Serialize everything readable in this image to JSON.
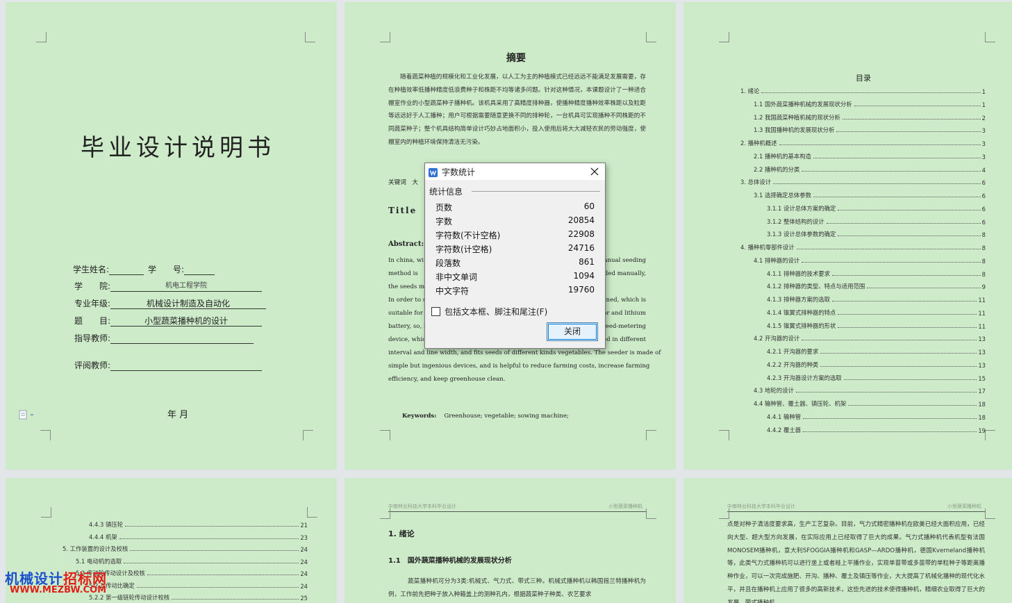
{
  "cover": {
    "title": "毕业设计说明书",
    "fields": [
      {
        "label": "学生姓名:",
        "value": ""
      },
      {
        "label": "学　　号:",
        "value": ""
      },
      {
        "label": "学　　院:",
        "value": "机电工程学院"
      },
      {
        "label": "专业年级:",
        "value": "机械设计制造及自动化"
      },
      {
        "label": "题　　目:",
        "value": "小型蔬菜播种机的设计"
      },
      {
        "label": "指导教师:",
        "value": ""
      },
      {
        "label": "评阅教师:",
        "value": ""
      }
    ],
    "date": "年  月"
  },
  "abstract_page": {
    "heading": "摘要",
    "zh_text": "随着蔬菜种植的规模化和工业化发展，以人工为主的种植模式已经远远不能满足发展需要，存在种植效率低播种精度低浪费种子和株距不均等诸多问题。针对这种情况，本课题设计了一种适合棚室作业的小型蔬菜种子播种机。该机具采用了高精度排种器，使播种精度播种效率株距以及粒距等远远好于人工播种；用户可根据需要随意更换不同的排种轮，一台机具可实现播种不同株距的不同蔬菜种子；整个机具结构简单设计巧妙占地面积小，投入使用后将大大减轻农民的劳动强度，使棚室内的种植环境保持清洁无污染。",
    "keywords_zh": "关键词　大",
    "title_label": "Title",
    "abstract_label": "Abstract:",
    "en_lines": [
      "In china, wi",
      "method is",
      "the seeds ma",
      "In order to so",
      "suitable for",
      "battery, so, it",
      "device, whic",
      "interval and line width, and fits seeds of different kinds vegetables. The seeder is made of",
      "simple but ingenious devices, and is helpful to reduce farming costs, increase farming",
      "efficiency, and keep greenhouse clean."
    ],
    "en_right": [
      "manual seeding",
      "eded manually,",
      "",
      "igned, which is",
      "or and lithium",
      "seed-metering",
      "ed in different"
    ],
    "keywords_label": "Keywords:",
    "keywords_en": "Greenhouse; vegetable; sowing machine;"
  },
  "toc_page": {
    "heading": "目录",
    "entries": [
      {
        "text": "1.  绪论",
        "page": "1",
        "level": 0
      },
      {
        "text": "1.1  国外蔬菜播种机械的发展现状分析",
        "page": "1",
        "level": 1
      },
      {
        "text": "1.2  我国蔬菜种植机械的现状分析",
        "page": "2",
        "level": 1
      },
      {
        "text": "1.3  我国播种机的发展现状分析",
        "page": "3",
        "level": 1
      },
      {
        "text": "2.  播种机概述",
        "page": "3",
        "level": 0
      },
      {
        "text": "2.1  播种机的基本构造",
        "page": "3",
        "level": 1
      },
      {
        "text": "2.2  播种机的分类",
        "page": "4",
        "level": 1
      },
      {
        "text": "3.  总体设计",
        "page": "6",
        "level": 0
      },
      {
        "text": "3.1  选择确定总体参数",
        "page": "6",
        "level": 1
      },
      {
        "text": "3.1.1  设计总体方案的确定",
        "page": "6",
        "level": 2
      },
      {
        "text": "3.1.2  整体结构的设计",
        "page": "6",
        "level": 2
      },
      {
        "text": "3.1.3  设计总体参数的确定",
        "page": "8",
        "level": 2
      },
      {
        "text": "4.  播种机零部件设计",
        "page": "8",
        "level": 0
      },
      {
        "text": "4.1  排种器的设计",
        "page": "8",
        "level": 1
      },
      {
        "text": "4.1.1  排种器的技术要求",
        "page": "8",
        "level": 2
      },
      {
        "text": "4.1.2  排种器的类型、特点与适用范围",
        "page": "9",
        "level": 2
      },
      {
        "text": "4.1.3  排种器方案的选取",
        "page": "11",
        "level": 2
      },
      {
        "text": "4.1.4  锥翼式排种器的特点",
        "page": "11",
        "level": 2
      },
      {
        "text": "4.1.5  锥翼式排种器的形状",
        "page": "11",
        "level": 2
      },
      {
        "text": "4.2  开沟器的设计",
        "page": "13",
        "level": 1
      },
      {
        "text": "4.2.1  开沟器的要求",
        "page": "13",
        "level": 2
      },
      {
        "text": "4.2.2  开沟器的种类",
        "page": "13",
        "level": 2
      },
      {
        "text": "4.2.3  开沟器设计方案的选取",
        "page": "15",
        "level": 2
      },
      {
        "text": "4.3  地轮的设计",
        "page": "17",
        "level": 1
      },
      {
        "text": "4.4  输种管、覆土器、镇压轮、机架",
        "page": "18",
        "level": 1
      },
      {
        "text": "4.4.1  输种管",
        "page": "18",
        "level": 2
      },
      {
        "text": "4.4.2  覆土器",
        "page": "19",
        "level": 2
      }
    ]
  },
  "toc_page2": {
    "entries": [
      {
        "text": "4.4.3  镇压轮",
        "page": "21",
        "level": 2
      },
      {
        "text": "4.4.4  机架",
        "page": "23",
        "level": 2
      },
      {
        "text": "5.  工作装置的设计及校核",
        "page": "24",
        "level": 0
      },
      {
        "text": "5.1  电动机的选取",
        "page": "24",
        "level": 1
      },
      {
        "text": "5.2  传动轮传动设计及校核",
        "page": "24",
        "level": 1
      },
      {
        "text": "5.2.1  传动比确定",
        "page": "24",
        "level": 2
      },
      {
        "text": "5.2.2  第一级链轮传动设计校核",
        "page": "25",
        "level": 2
      }
    ]
  },
  "chapter_page": {
    "header_left": "中南林业科技大学本科毕业设计",
    "header_right": "小型蔬菜播种机",
    "h1": "1.  绪论",
    "h2": "1.1　国外蔬菜播种机械的发展现状分析",
    "body": "蔬菜播种机可分为3类:机械式、气力式、带式三种。机械式播种机以韩国摇兰特播种机为例，工作前先把种子放入种箱盖上的测种孔内，根据蔬菜种子种类、农艺要求"
  },
  "cont_page": {
    "header_left": "中南林业科技大学本科毕业设计",
    "header_right": "小型蔬菜播种机",
    "body": "点是对种子清洁度要求高，生产工艺复杂。目前，气力式精密播种机在欧美已经大面积应用，已经向大型、超大型方向发展，在实际应用上已经取得了巨大的成果。气力式播种机代表机型有法国MONOSEM播种机，意大利SFOGGIA播种机和GASP—ARDO播种机，德国Kverneland播种机等，此类气力式播种机可以进行垄上或者畦上平播作业，实现单苗带或多苗带的单粒种子等距离播种作业，可以一次完成施肥、开沟、播种、覆土及镇压等作业，大大提高了机械化播种的现代化水平，并且在播种机上应用了很多的高新技术，这些先进的技术使得播种机，精细农业取得了巨大的发展。带式播种机"
  },
  "dialog": {
    "title": "字数统计",
    "section": "统计信息",
    "stats": [
      {
        "label": "页数",
        "value": "60"
      },
      {
        "label": "字数",
        "value": "20854"
      },
      {
        "label": "字符数(不计空格)",
        "value": "22908"
      },
      {
        "label": "字符数(计空格)",
        "value": "24716"
      },
      {
        "label": "段落数",
        "value": "861"
      },
      {
        "label": "非中文单词",
        "value": "1094"
      },
      {
        "label": "中文字符",
        "value": "19760"
      }
    ],
    "checkbox_label": "包括文本框、脚注和尾注(F)",
    "checkbox_checked": false,
    "close_label": "关闭"
  },
  "watermark": {
    "line1": "机械设计招标网",
    "line2": "WWW.MEZBW.COM"
  },
  "colors": {
    "page_bg": "#cdebc9",
    "workspace_bg": "#e3e6e8",
    "dialog_bg": "#f0f0f0",
    "accent": "#0078d7",
    "watermark_red": "#e0201a",
    "watermark_blue": "#1a4fd0"
  }
}
